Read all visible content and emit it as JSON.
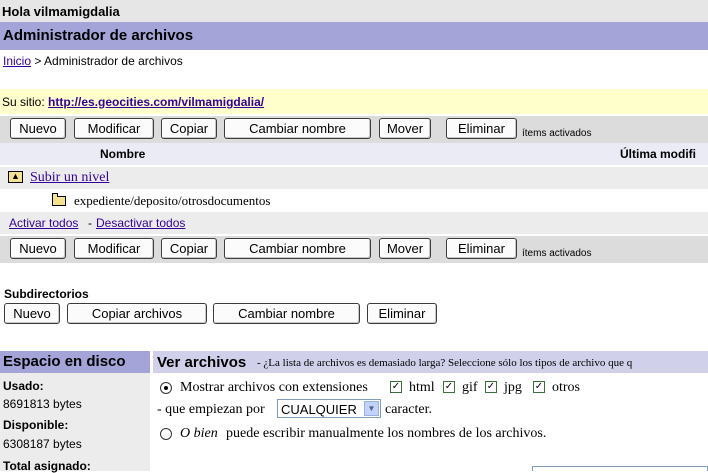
{
  "greeting": "Hola vilmamigdalia",
  "page_title": "Administrador de archivos",
  "breadcrumb": {
    "home": "Inicio",
    "separator": ">",
    "current": "Administrador de archivos"
  },
  "site": {
    "label": "Su sitio:",
    "url": "http://es.geocities.com/vilmamigdalia/"
  },
  "toolbar": {
    "new": "Nuevo",
    "modify": "Modificar",
    "copy": "Copiar",
    "rename": "Cambiar nombre",
    "move": "Mover",
    "delete": "Eliminar",
    "items_active": "ítems activados"
  },
  "file_table": {
    "col_name": "Nombre",
    "col_modified": "Última modifi",
    "up_level": "Subir un nivel",
    "path": "expediente/deposito/otrosdocumentos",
    "select_all": "Activar todos",
    "dash": "-",
    "deselect_all": "Desactivar todos"
  },
  "subdirs": {
    "title": "Subdirectorios",
    "new": "Nuevo",
    "copy_files": "Copiar archivos",
    "rename": "Cambiar nombre",
    "delete": "Eliminar"
  },
  "disk": {
    "title": "Espacio en disco",
    "used_label": "Usado:",
    "used_value": "8691813 bytes",
    "available_label": "Disponible:",
    "available_value": "6308187 bytes",
    "total_label": "Total asignado:"
  },
  "view": {
    "title": "Ver archivos",
    "hint": "- ¿La lista de archivos es demasiado larga? Seleccione sólo los tipos de archivo que q",
    "show_with_ext": "Mostrar archivos con extensiones",
    "ext_html": "html",
    "ext_gif": "gif",
    "ext_jpg": "jpg",
    "ext_other": "otros",
    "starts_with": "- que empiezan por",
    "select_value": "CUALQUIER",
    "character": "caracter.",
    "or_else": "O bien",
    "manual_text": "puede escribir manualmente los nombres de los archivos."
  },
  "colors": {
    "title_band": "#a4a4d8",
    "site_band": "#ffffcc",
    "link": "#330099"
  }
}
